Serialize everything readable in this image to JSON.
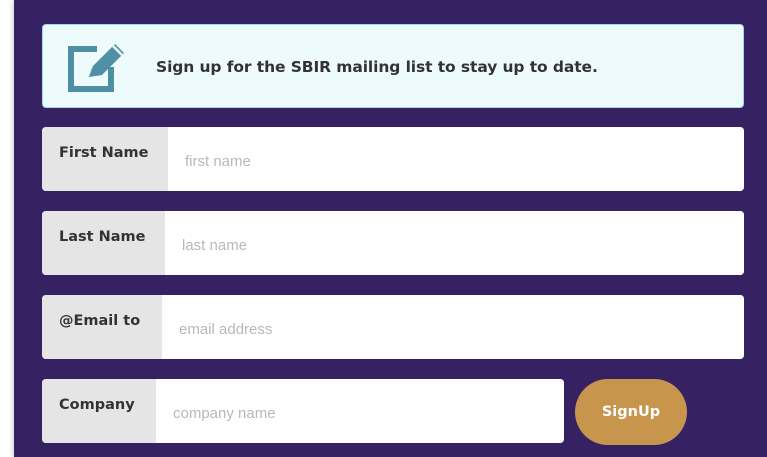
{
  "banner": {
    "icon": "edit-icon",
    "text": "Sign up for the SBIR mailing list to stay up to date."
  },
  "form": {
    "first_name": {
      "label": "First Name",
      "placeholder": "first name",
      "value": ""
    },
    "last_name": {
      "label": "Last Name",
      "placeholder": "last name",
      "value": ""
    },
    "email": {
      "label": "@Email to",
      "placeholder": "email address",
      "value": ""
    },
    "company": {
      "label": "Company",
      "placeholder": "company name",
      "value": ""
    },
    "submit_label": "SignUp"
  },
  "colors": {
    "panel_background": "#362163",
    "banner_background": "#eefbfd",
    "banner_border": "#9fd8e8",
    "icon_color": "#4f8fa3",
    "label_background": "#e5e5e5",
    "button_background": "#c8954d"
  }
}
